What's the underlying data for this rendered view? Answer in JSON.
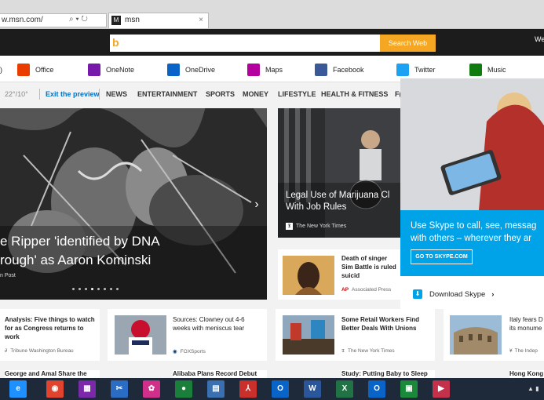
{
  "browser": {
    "address": "w.msn.com/",
    "address_icons": "⌕ ▾ ↻",
    "tab_title": "msn",
    "tab_favicon": "M",
    "tab_close": "×"
  },
  "header": {
    "bing_glyph": "b",
    "search_button": "Search Web",
    "right_text": "We"
  },
  "apps": [
    {
      "label": "Office",
      "icon": "office-icon",
      "color": "#eb3c00"
    },
    {
      "label": "OneNote",
      "icon": "onenote-icon",
      "color": "#7719aa"
    },
    {
      "label": "OneDrive",
      "icon": "onedrive-icon",
      "color": "#0a64c8"
    },
    {
      "label": "Maps",
      "icon": "maps-icon",
      "color": "#b4009e"
    },
    {
      "label": "Facebook",
      "icon": "facebook-icon",
      "color": "#3b5998"
    },
    {
      "label": "Twitter",
      "icon": "twitter-icon",
      "color": "#1da1f2"
    },
    {
      "label": "Music",
      "icon": "xbox-music-icon",
      "color": "#107c10"
    }
  ],
  "left_fragment": ")",
  "nav": {
    "weather": "22°/10°",
    "exit_preview": "Exit the preview",
    "sections": [
      "NEWS",
      "ENTERTAINMENT",
      "SPORTS",
      "MONEY",
      "LIFESTYLE",
      "HEALTH & FITNESS",
      "F("
    ]
  },
  "hero": {
    "title_line1": "e Ripper 'identified by DNA",
    "title_line2": "rough' as Aaron Kominski",
    "source": "n Post",
    "arrow": "›",
    "dots": 8,
    "active_dot": 3
  },
  "card2": {
    "title_line1": "Legal Use of Marijuana Cl",
    "title_line2": "With Job Rules",
    "source": "The New York Times"
  },
  "card3": {
    "title": "Death of singer Sim Battle is ruled suicid",
    "source": "Associated Press",
    "source_badge": "AP"
  },
  "ad": {
    "text_line1": "Use Skype to call, see, messag",
    "text_line2": "with others – wherever they ar",
    "button": "GO TO SKYPE.COM",
    "download": "Download Skype",
    "download_arrow": "›"
  },
  "bottom_cards": [
    {
      "title": "Analysis: Five things to watch for as Congress returns to work",
      "source": "Tribune Washington Bureau"
    },
    {
      "title": "Sources: Clowney out 4-6 weeks with meniscus tear",
      "source": "FOXSports"
    },
    {
      "title": "Some Retail Workers Find Better Deals With Unions",
      "source": "The New York Times"
    },
    {
      "title": "Italy fears D its monume",
      "source": "The Indep"
    }
  ],
  "peek": [
    "George and Amal Share the",
    "Alibaba Plans Record Debut",
    "Study: Putting Baby to Sleep",
    "Hong Kong"
  ],
  "taskbar": {
    "items": [
      {
        "name": "ie-icon",
        "glyph": "e",
        "color": "#1e90ff"
      },
      {
        "name": "chrome-icon",
        "glyph": "◉",
        "color": "#e0442f"
      },
      {
        "name": "windows-store-icon",
        "glyph": "▦",
        "color": "#7a2aa8"
      },
      {
        "name": "snipping-icon",
        "glyph": "✂",
        "color": "#2b6cc4"
      },
      {
        "name": "app-pink-icon",
        "glyph": "✿",
        "color": "#d02f8a"
      },
      {
        "name": "app-green-icon",
        "glyph": "●",
        "color": "#1a7f3a"
      },
      {
        "name": "calculator-icon",
        "glyph": "▤",
        "color": "#3a6fb0"
      },
      {
        "name": "pdf-icon",
        "glyph": "⅄",
        "color": "#c9302c"
      },
      {
        "name": "outlook-icon",
        "glyph": "O",
        "color": "#0a64c8"
      },
      {
        "name": "word-icon",
        "glyph": "W",
        "color": "#2b579a"
      },
      {
        "name": "excel-icon",
        "glyph": "X",
        "color": "#217346"
      },
      {
        "name": "outlook2-icon",
        "glyph": "O",
        "color": "#0a64c8"
      },
      {
        "name": "store-icon",
        "glyph": "▣",
        "color": "#1a8a3a"
      },
      {
        "name": "video-icon",
        "glyph": "▶",
        "color": "#c4314b"
      }
    ],
    "tray": "▲ ▮"
  }
}
